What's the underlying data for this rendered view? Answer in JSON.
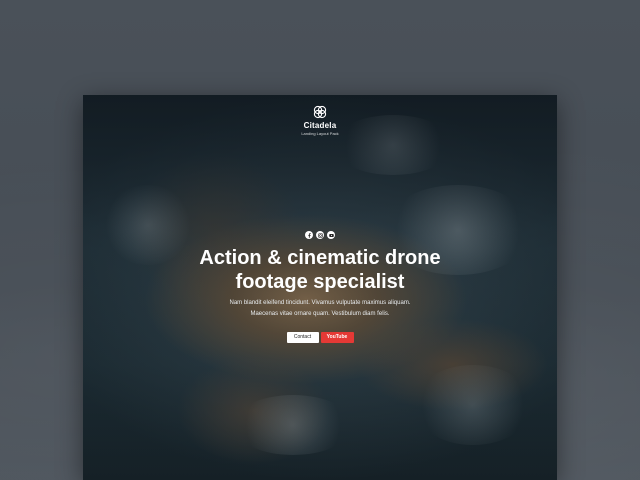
{
  "brand": {
    "name": "Citadela",
    "tagline": "Landing Layout Pack"
  },
  "hero": {
    "headline_line1": "Action & cinematic drone",
    "headline_line2": "footage specialist",
    "sub_line1": "Nam blandit eleifend tincidunt. Vivamus vulputate maximus aliquam.",
    "sub_line2": "Maecenas vitae ornare quam. Vestibulum diam felis."
  },
  "socials": [
    {
      "icon": "facebook-icon"
    },
    {
      "icon": "instagram-icon"
    },
    {
      "icon": "youtube-icon"
    }
  ],
  "buttons": {
    "contact_label": "Contact",
    "youtube_label": "YouTube"
  },
  "colors": {
    "accent": "#e53935",
    "page_bg": "#4a5159"
  }
}
